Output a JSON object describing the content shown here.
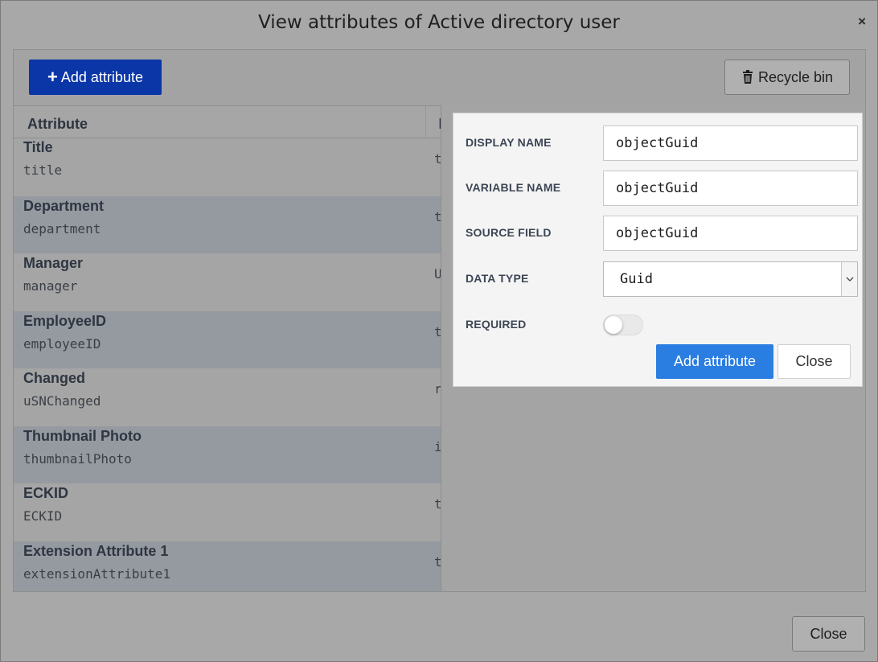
{
  "dialog": {
    "title": "View attributes of Active directory user",
    "close_glyph": "×",
    "footer_close_label": "Close"
  },
  "toolbar": {
    "add_label": "Add attribute",
    "add_icon": "plus-icon",
    "recycle_label": "Recycle bin",
    "recycle_icon": "trash-icon"
  },
  "table": {
    "column_headers": [
      "Attribute",
      "I"
    ],
    "rows": [
      {
        "display_name": "Title",
        "variable": "title",
        "type_initial": "t"
      },
      {
        "display_name": "Department",
        "variable": "department",
        "type_initial": "t"
      },
      {
        "display_name": "Manager",
        "variable": "manager",
        "type_initial": "U"
      },
      {
        "display_name": "EmployeeID",
        "variable": "employeeID",
        "type_initial": "t"
      },
      {
        "display_name": "Changed",
        "variable": "uSNChanged",
        "type_initial": "r"
      },
      {
        "display_name": "Thumbnail Photo",
        "variable": "thumbnailPhoto",
        "type_initial": "i"
      },
      {
        "display_name": "ECKID",
        "variable": "ECKID",
        "type_initial": "t"
      },
      {
        "display_name": "Extension Attribute 1",
        "variable": "extensionAttribute1",
        "type_initial": "t"
      }
    ]
  },
  "form": {
    "display_name": {
      "label": "DISPLAY NAME",
      "value": "objectGuid"
    },
    "variable_name": {
      "label": "VARIABLE NAME",
      "value": "objectGuid"
    },
    "source_field": {
      "label": "SOURCE FIELD",
      "value": "objectGuid"
    },
    "data_type": {
      "label": "DATA TYPE",
      "value": "Guid"
    },
    "required": {
      "label": "REQUIRED",
      "on": false
    },
    "submit_label": "Add attribute",
    "close_label": "Close"
  },
  "colors": {
    "primary_dark": "#0a36a8",
    "primary": "#2a7de1",
    "overlay_gray": "#a8a8a8"
  }
}
